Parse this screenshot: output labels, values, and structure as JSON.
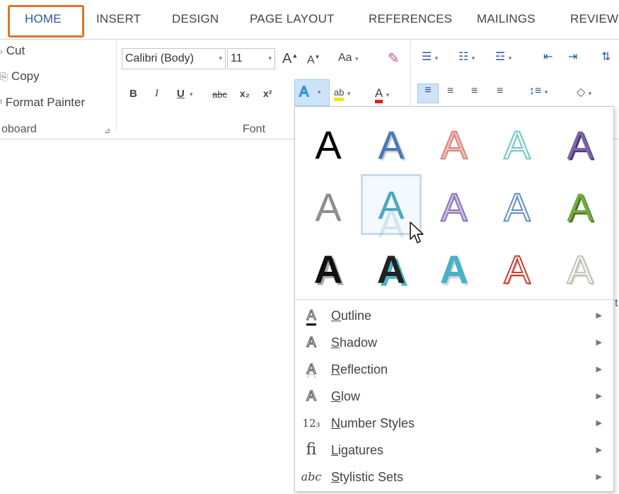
{
  "tabs": [
    {
      "label": "HOME",
      "active": true
    },
    {
      "label": "INSERT",
      "active": false
    },
    {
      "label": "DESIGN",
      "active": false
    },
    {
      "label": "PAGE LAYOUT",
      "active": false
    },
    {
      "label": "REFERENCES",
      "active": false
    },
    {
      "label": "MAILINGS",
      "active": false
    },
    {
      "label": "REVIEW",
      "active": false
    }
  ],
  "clipboard": {
    "cut_label": "Cut",
    "copy_label": "Copy",
    "format_painter_label": "Format Painter",
    "group_label": "oboard"
  },
  "font": {
    "font_name": "Calibri (Body)",
    "font_size": "11",
    "change_case_label": "Aa",
    "group_label": "Font",
    "bold": "B",
    "italic": "I",
    "underline": "U",
    "strikethrough": "abc",
    "subscript": "x₂",
    "superscript": "x²",
    "effects_icon": "A",
    "highlight_icon": "ab",
    "font_color_icon": "A",
    "grow_font": "A",
    "shrink_font": "A"
  },
  "gallery": {
    "glyph": "A",
    "rows": [
      [
        "black-fill",
        "blue-fill-shadow",
        "red-outline-gradient",
        "teal-outline-glow",
        "purple-fill"
      ],
      [
        "gray-fill",
        "teal-reflection",
        "lavender-bevel",
        "blue-outline",
        "green-bevel"
      ],
      [
        "black-shadow",
        "black-teal-shadow",
        "teal-bold",
        "red-outline",
        "white-bevel"
      ]
    ],
    "selected": "teal-reflection"
  },
  "menu": [
    {
      "key": "O",
      "rest": "utline",
      "icon": "outline-icon"
    },
    {
      "key": "S",
      "rest": "hadow",
      "icon": "shadow-icon"
    },
    {
      "key": "R",
      "rest": "eflection",
      "icon": "reflection-icon"
    },
    {
      "key": "G",
      "rest": "low",
      "icon": "glow-icon"
    },
    {
      "key": "N",
      "rest": "umber Styles",
      "icon": "number-styles-icon"
    },
    {
      "key": "L",
      "rest": "igatures",
      "icon": "ligatures-icon"
    },
    {
      "key": "S",
      "rest": "tylistic Sets",
      "icon": "stylistic-sets-icon"
    }
  ],
  "colors": {
    "accent": "#2b579a",
    "highlight_border": "#d9772a",
    "selected_button": "#cde3f7"
  }
}
